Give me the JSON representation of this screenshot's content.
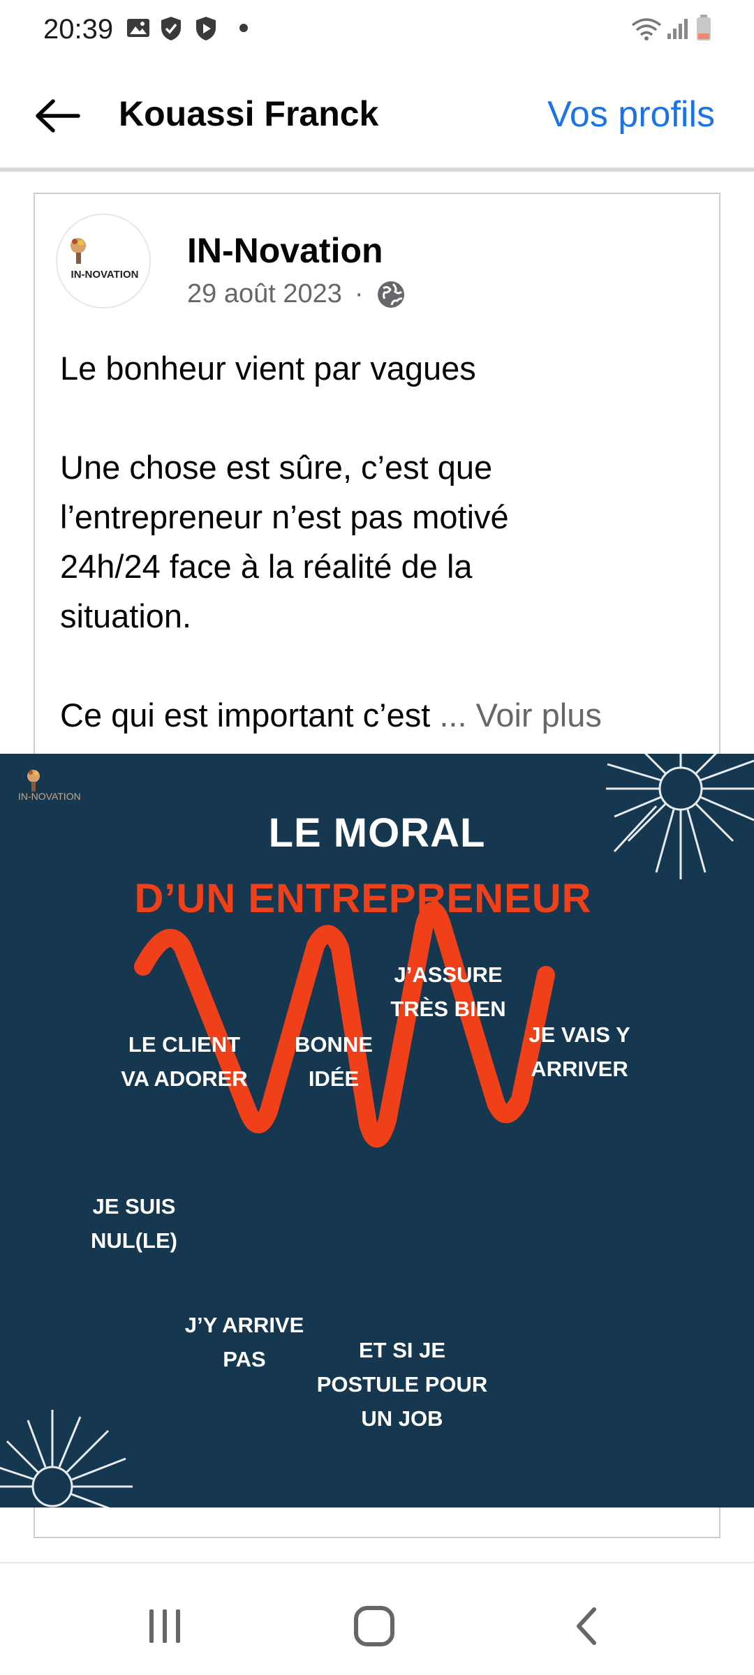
{
  "status_bar": {
    "time": "20:39",
    "left_icons": [
      "gallery-icon",
      "shield-check-icon",
      "shield-play-icon",
      "dot-icon"
    ],
    "right_icons": [
      "wifi-icon",
      "signal-icon",
      "battery-icon"
    ]
  },
  "header": {
    "title": "Kouassi Franck",
    "link": "Vos profils"
  },
  "post": {
    "page_name": "IN-Novation",
    "date": "29 août 2023",
    "separator": "·",
    "privacy_icon": "globe-icon",
    "avatar_logo_text": "IN-NOVATION",
    "paragraph1": "Le bonheur vient par vagues",
    "paragraph2": "Une chose est sûre, c’est que\nl’entrepreneur n’est pas motivé\n24h/24 face à la réalité de la\nsituation.",
    "paragraph3": "Ce qui est important c’est",
    "see_more": "... Voir plus"
  },
  "image": {
    "logo_text": "IN-NOVATION",
    "title_line1": "LE MORAL",
    "title_line2": "D’UN ENTREPRENEUR",
    "accent_color": "#f0401a",
    "background_color": "#163750",
    "labels": {
      "je_suis_nul": "JE SUIS\nNUL(LE)",
      "le_client": "LE CLIENT\nVA ADORER",
      "jy_arrive_pas": "J’Y ARRIVE\nPAS",
      "bonne_idee": "BONNE\nIDÉE",
      "et_si_je": "ET SI JE\nPOSTULE POUR\nUN JOB",
      "jassure": "J’ASSURE\nTRÈS BIEN",
      "je_vais": "JE VAIS Y\nARRIVER"
    }
  },
  "bottom_nav": {
    "recents_icon": "recents-icon",
    "home_icon": "home-icon",
    "back_icon": "back-chevron-icon"
  }
}
